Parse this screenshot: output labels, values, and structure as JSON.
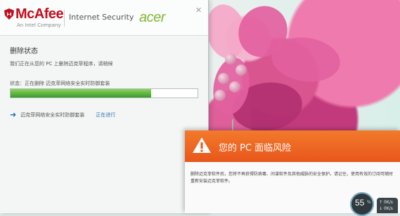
{
  "app": {
    "brand": "McAfee",
    "brand_sub": "An Intel Company",
    "product": "Internet Security",
    "partner": "acer"
  },
  "panel": {
    "section_title": "删除状态",
    "description": "我们正在从您的 PC 上删除迈克菲程序，请稍候",
    "status_label": "状态：正在删除 迈克菲网络安全实时防御套装",
    "progress_percent": 75,
    "step_label": "迈克菲网络安全实时防御套装",
    "step_status": "正在进行"
  },
  "alert": {
    "title": "您的 PC 面临风险",
    "body": "删除迈克菲软件后，您将不再获得防病毒、间谍软件及其他威胁的安全保护。请记住，使用有效的订阅可随时重新安装迈克菲软件。",
    "accent_color": "#ef6a24"
  },
  "taskbar_widget": {
    "gauge_value": "55",
    "gauge_unit": "%",
    "speed_up": "0K/s",
    "speed_down": "0K/s"
  },
  "colors": {
    "brand_red": "#c40d1d",
    "acer_green": "#83b735",
    "progress_green": "#5bb33c"
  }
}
